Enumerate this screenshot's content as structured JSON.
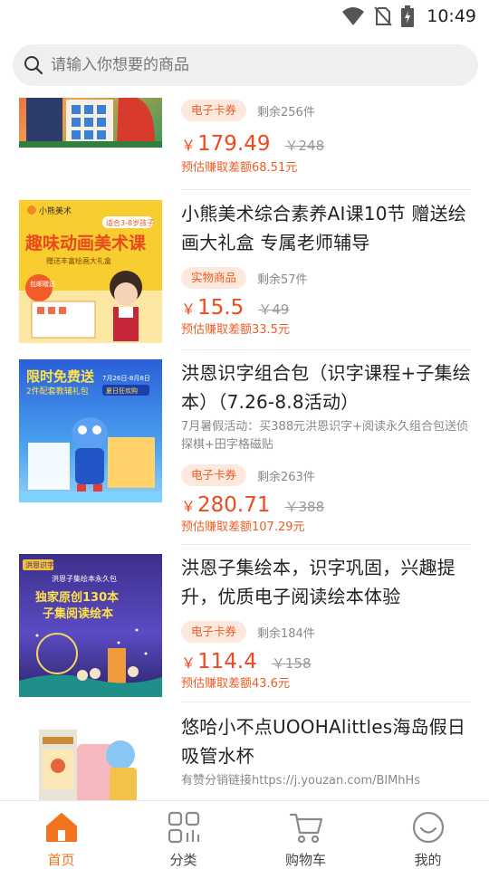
{
  "status_bar": {
    "time": "10:49",
    "icons": [
      "wifi-icon",
      "no-sim-icon",
      "battery-charging-icon"
    ]
  },
  "search": {
    "placeholder": "请输入你想要的商品",
    "icon": "search-icon"
  },
  "products": [
    {
      "id": 1,
      "title_tail": "",
      "tag": "电子卡券",
      "stock": "剩余256件",
      "currency": "￥",
      "price": "179.49",
      "original_price": "￥248",
      "earn": "预估赚取差额68.51元"
    },
    {
      "id": 2,
      "title": "小熊美术综合素养AI课10节 赠送绘画大礼盒 专属老师辅导",
      "tag": "实物商品",
      "stock": "剩余57件",
      "currency": "￥",
      "price": "15.5",
      "original_price": "￥49",
      "earn": "预估赚取差额33.5元",
      "image_text": {
        "brand": "小熊美术",
        "badge": "适合3-8岁孩子",
        "headline": "趣味动画美术课",
        "sub": "赠送丰富绘画大礼盒",
        "bubble": "包邮赠送"
      }
    },
    {
      "id": 3,
      "title": "洪恩识字组合包（识字课程+子集绘本）（7.26-8.8活动）",
      "desc": "7月暑假活动：买388元洪恩识字+阅读永久组合包送侦探棋+田字格磁贴",
      "tag": "电子卡券",
      "stock": "剩余263件",
      "currency": "￥",
      "price": "280.71",
      "original_price": "￥388",
      "earn": "预估赚取差额107.29元",
      "image_text": {
        "line1": "限时免费送",
        "line2": "2件配套教辅礼包",
        "date": "7月26日-8月8日",
        "tag": "夏日狂欢购"
      }
    },
    {
      "id": 4,
      "title": "洪恩子集绘本，识字巩固，兴趣提升，优质电子阅读绘本体验",
      "tag": "电子卡券",
      "stock": "剩余184件",
      "currency": "￥",
      "price": "114.4",
      "original_price": "￥158",
      "earn": "预估赚取差额43.6元",
      "image_text": {
        "brand": "洪恩识字",
        "sub": "洪恩子集绘本永久包",
        "line1": "独家原创130本",
        "line2": "子集阅读绘本"
      }
    },
    {
      "id": 5,
      "title": "悠哈小不点UOOHAlittles海岛假日吸管水杯",
      "desc": "有赞分销链接https://j.youzan.com/BlMhHs"
    }
  ],
  "nav": [
    {
      "label": "首页",
      "icon": "home-icon",
      "active": true
    },
    {
      "label": "分类",
      "icon": "category-icon",
      "active": false
    },
    {
      "label": "购物车",
      "icon": "cart-icon",
      "active": false
    },
    {
      "label": "我的",
      "icon": "profile-icon",
      "active": false
    }
  ],
  "colors": {
    "accent": "#ee4a1c",
    "tag_bg": "#fde8dd",
    "nav_active": "#f2731d"
  }
}
